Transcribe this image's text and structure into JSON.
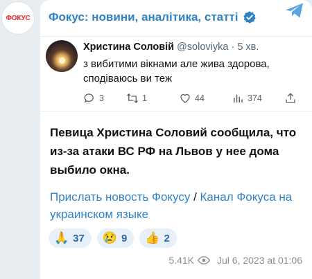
{
  "channel": {
    "logo_text": "ФОКУС",
    "title": "Фокус: новини, аналітика, статті"
  },
  "tweet": {
    "name": "Христина Соловій",
    "meta": "@soloviyka · 5 хв.",
    "text": "з вибитими вікнами але жива здорова, сподіваюсь ви теж",
    "replies": "3",
    "retweets": "1",
    "likes": "44",
    "views": "374"
  },
  "post": {
    "text": "Певица Христина Соловий сообщила, что из-за атаки ВС РФ на Львов у нее дома выбило окна.",
    "link1": "Прислать новость Фокусу",
    "separator": " / ",
    "link2": "Канал Фокуса на украинском языке"
  },
  "reactions": [
    {
      "emoji": "🙏",
      "count": "37"
    },
    {
      "emoji": "😢",
      "count": "9"
    },
    {
      "emoji": "👍",
      "count": "2"
    }
  ],
  "footer": {
    "views": "5.41K",
    "date": "Jul 6, 2023 at 01:06"
  },
  "colors": {
    "accent": "#2f83c4",
    "logo": "#e8262c"
  }
}
